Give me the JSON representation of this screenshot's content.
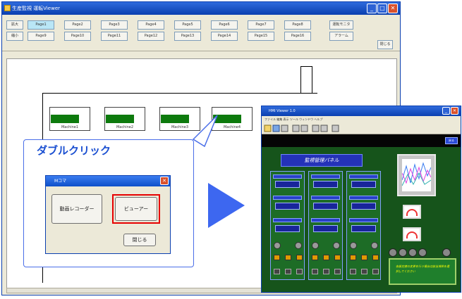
{
  "main_window": {
    "title": "生産監視  運転Viewer",
    "buttons_left": [
      "拡大",
      "縮小"
    ],
    "page_tabs_row1": [
      "Page1",
      "Page2",
      "Page3",
      "Page4",
      "Page5",
      "Page6",
      "Page7",
      "Page8"
    ],
    "page_tabs_row2": [
      "Page9",
      "Page10",
      "Page11",
      "Page12",
      "Page13",
      "Page14",
      "Page15",
      "Page16"
    ],
    "right_buttons": [
      "運転モニタ",
      "アラーム"
    ],
    "close_small": "閉じる"
  },
  "machines": [
    "Machine1",
    "Machine2",
    "Machine3",
    "Machine4"
  ],
  "callout": {
    "label": "ダブルクリック"
  },
  "dialog": {
    "title": "Mコマ",
    "button_recorder": "動画レコーダー",
    "button_viewer": "ビューアー",
    "button_close": "閉じる"
  },
  "hmi": {
    "title": "HMI Viewer 1.0",
    "menu": "ファイル  編集  表示  ツール  ウィンドウ  ヘルプ",
    "top_button": "戻る",
    "panel_title": "監視管理パネル",
    "message": "各設定値の変更を行う場合は該当項目を選択してください"
  },
  "colors": {
    "accent_blue": "#1a4fd1",
    "arrow": "#3d67f0",
    "highlight": "#e60000",
    "hmi_bg": "#16541b",
    "machine_bar": "#0d7a0d"
  }
}
